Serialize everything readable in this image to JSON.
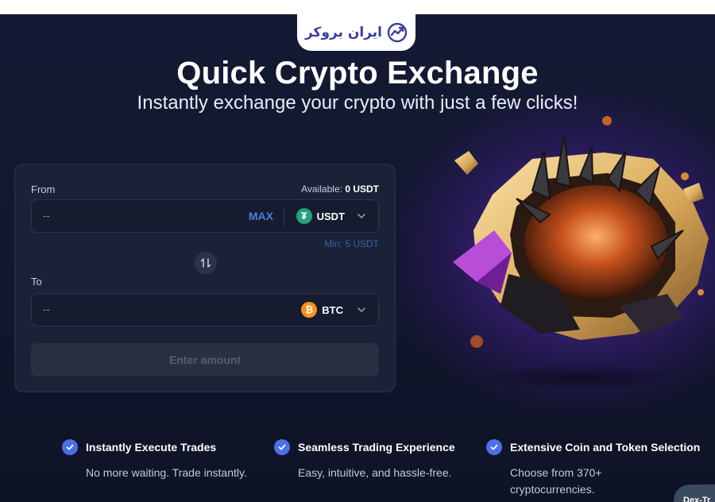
{
  "brand": {
    "logo_text": "ایران بروکر"
  },
  "hero": {
    "title": "Quick Crypto Exchange",
    "subtitle": "Instantly exchange your crypto with just a few clicks!"
  },
  "exchange": {
    "from_label": "From",
    "available_label": "Available:",
    "available_value": "0 USDT",
    "from_value": "--",
    "max_label": "MAX",
    "from_coin": "USDT",
    "min_label": "Min: 5 USDT",
    "to_label": "To",
    "to_value": "--",
    "to_coin": "BTC",
    "submit_label": "Enter amount"
  },
  "features": [
    {
      "title": "Instantly Execute Trades",
      "desc": "No more waiting. Trade instantly."
    },
    {
      "title": "Seamless Trading Experience",
      "desc": "Easy, intuitive, and hassle-free."
    },
    {
      "title": "Extensive Coin and Token Selection",
      "desc": "Choose from 370+ cryptocurrencies."
    }
  ],
  "corner_tab": {
    "label": "Dex-Tr"
  },
  "colors": {
    "accent": "#4c6ee8",
    "max": "#4d7ee0",
    "usdt": "#26a17b",
    "btc": "#f7931a",
    "background": "#151a34"
  }
}
